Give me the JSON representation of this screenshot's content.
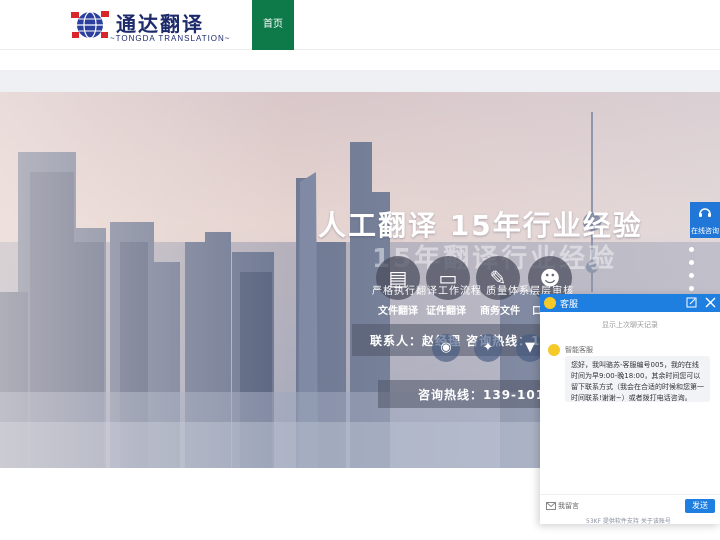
{
  "header": {
    "logo_name": "通达翻译",
    "logo_sub": "~TONGDA TRANSLATION~",
    "nav_home": "首页"
  },
  "banner": {
    "headline": "人工翻译 15年行业经验",
    "headline_echo": "15年翻译行业经验",
    "tagline": "严格执行翻译工作流程 质量体系层层审核",
    "services": [
      {
        "label": "文件翻译",
        "icon": "document-icon"
      },
      {
        "label": "证件翻译",
        "icon": "id-card-icon"
      },
      {
        "label": "商务文件",
        "icon": "business-file-icon"
      },
      {
        "label": "口",
        "icon": "people-icon"
      }
    ],
    "contact": "联系人：赵经理    咨询热线：1",
    "phone": "咨询热线：139-1019-"
  },
  "side": {
    "online_label": "在线咨询"
  },
  "chat": {
    "title": "客服",
    "history": "显示上次聊天记录",
    "agent_name": "智能客服",
    "message": "您好，我叫骆苏-客服编号005，我的在线时间为早9:00-晚18:00，其余时间您可以留下联系方式（我会在合适的时候和您第一时间联系!谢谢~）或者拨打电话咨询。",
    "leave_label": "我留言",
    "send_label": "发送",
    "powered": "53KF 提供软件支持  关于该账号"
  },
  "colors": {
    "brand_green": "#0e7a4a",
    "chat_blue": "#1f7fe0",
    "logo_navy": "#1c2a6b"
  }
}
